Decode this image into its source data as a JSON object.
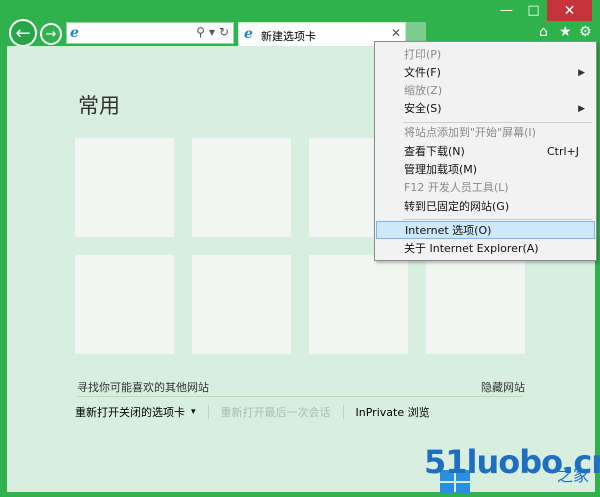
{
  "window": {
    "controls": {
      "minimize": "—",
      "maximize": "□",
      "close": "✕"
    }
  },
  "nav": {
    "back_icon": "back-arrow-icon",
    "forward_icon": "forward-arrow-icon",
    "back_glyph": "←",
    "forward_glyph": "→"
  },
  "address_bar": {
    "value": "",
    "search_glyph": "⚲",
    "dropdown_glyph": "▾",
    "refresh_glyph": "↻",
    "ie_glyph": "e"
  },
  "tab": {
    "title": "新建选项卡",
    "close_glyph": "✕",
    "ie_glyph": "e"
  },
  "toolbar": {
    "home_glyph": "⌂",
    "favorites_glyph": "★",
    "tools_glyph": "⚙"
  },
  "frequent": {
    "title": "常用",
    "find_sites": "寻找你可能喜欢的其他网站",
    "hide_sites": "隐藏网站",
    "reopen_closed_tabs": "重新打开关闭的选项卡",
    "reopen_arrow": "▾",
    "reopen_last_session": "重新打开最后一次会话",
    "inprivate": "InPrivate 浏览"
  },
  "menu": {
    "items": [
      {
        "label": "打印(P)",
        "disabled": true
      },
      {
        "label": "文件(F)",
        "submenu": true
      },
      {
        "label": "缩放(Z)",
        "disabled": true
      },
      {
        "label": "安全(S)",
        "submenu": true
      },
      {
        "label": "将站点添加到\"开始\"屏幕(I)",
        "disabled": true
      },
      {
        "label": "查看下载(N)",
        "shortcut": "Ctrl+J"
      },
      {
        "label": "管理加载项(M)"
      },
      {
        "label": "F12 开发人员工具(L)",
        "disabled": true
      },
      {
        "label": "转到已固定的网站(G)"
      },
      {
        "label": "Internet 选项(O)",
        "highlight": true
      },
      {
        "label": "关于 Internet Explorer(A)"
      }
    ],
    "arrow_glyph": "▶"
  },
  "watermark": {
    "text": "51luobo.cn",
    "suffix": "之家"
  },
  "colors": {
    "frame": "#2fb24c",
    "content": "#d8eede",
    "tile": "#f1f6f2",
    "menu_highlight": "#cde8f8",
    "close": "#c7333a"
  }
}
